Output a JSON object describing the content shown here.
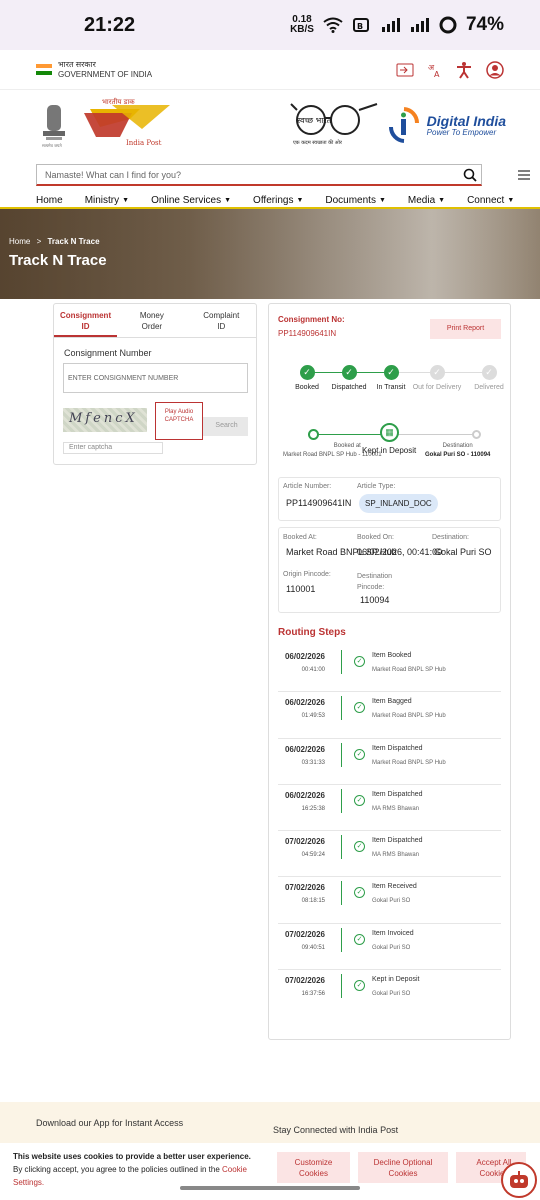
{
  "status_bar": {
    "time": "21:22",
    "speed_value": "0.18",
    "speed_unit": "KB/S",
    "battery": "74%"
  },
  "gov": {
    "hindi": "भारत सरकार",
    "english": "GOVERNMENT OF INDIA"
  },
  "logos": {
    "ip_hindi": "भारतीय डाक",
    "ip_english": "India Post",
    "swachh": "स्वच्छ भारत",
    "di_title": "Digital India",
    "di_sub": "Power To Empower"
  },
  "search": {
    "placeholder": "Namaste! What can I find for you?"
  },
  "nav": [
    "Home",
    "Ministry",
    "Online Services",
    "Offerings",
    "Documents",
    "Media",
    "Connect"
  ],
  "banner": {
    "crumb_home": "Home",
    "crumb_sep": ">",
    "crumb_current": "Track N Trace",
    "title": "Track N Trace"
  },
  "form": {
    "tabs": [
      "Consignment ID",
      "Money Order",
      "Complaint ID"
    ],
    "label": "Consignment Number",
    "input_placeholder": "ENTER CONSIGNMENT NUMBER",
    "captcha_text": "MfencX",
    "audio_label": "Play Audio CAPTCHA",
    "search_label": "Search",
    "captcha_placeholder": "Enter captcha"
  },
  "result": {
    "cons_label": "Consignment No:",
    "cons_no": "PP114909641IN",
    "print_label": "Print Report",
    "steps": [
      {
        "label": "Booked",
        "done": true
      },
      {
        "label": "Dispatched",
        "done": true
      },
      {
        "label": "In Transit",
        "done": true
      },
      {
        "label": "Out for Delivery",
        "done": false
      },
      {
        "label": "Delivered",
        "done": false
      }
    ],
    "journey": {
      "booked_at_label": "Booked at",
      "booked_at": "Market Road BNPL SP Hub - 110001",
      "status": "Kept in Deposit",
      "dest_label": "Destination",
      "dest": "Gokal Puri SO - 110094"
    },
    "article_number_label": "Article Number:",
    "article_number": "PP114909641IN",
    "article_type_label": "Article Type:",
    "article_type": "SP_INLAND_DOC",
    "booked_at_label": "Booked At:",
    "booked_at": "Market Road BNPL SP Hub",
    "booked_on_label": "Booked On:",
    "booked_on": "06/02/2026, 00:41:00",
    "destination_label": "Destination:",
    "destination": "Gokal Puri SO",
    "origin_pin_label": "Origin Pincode:",
    "origin_pin": "110001",
    "dest_pin_label": "Destination Pincode:",
    "dest_pin": "110094",
    "routing_title": "Routing Steps",
    "routing": [
      {
        "date": "06/02/2026",
        "time": "00:41:00",
        "event": "Item Booked",
        "office": "Market Road BNPL SP Hub"
      },
      {
        "date": "06/02/2026",
        "time": "01:49:53",
        "event": "Item Bagged",
        "office": "Market Road BNPL SP Hub"
      },
      {
        "date": "06/02/2026",
        "time": "03:31:33",
        "event": "Item Dispatched",
        "office": "Market Road BNPL SP Hub"
      },
      {
        "date": "06/02/2026",
        "time": "16:25:38",
        "event": "Item Dispatched",
        "office": "MA RMS Bhawan"
      },
      {
        "date": "07/02/2026",
        "time": "04:59:24",
        "event": "Item Dispatched",
        "office": "MA RMS Bhawan"
      },
      {
        "date": "07/02/2026",
        "time": "08:18:15",
        "event": "Item Received",
        "office": "Gokal Puri SO"
      },
      {
        "date": "07/02/2026",
        "time": "09:40:51",
        "event": "Item Invoiced",
        "office": "Gokal Puri SO"
      },
      {
        "date": "07/02/2026",
        "time": "16:37:56",
        "event": "Kept in Deposit",
        "office": "Gokal Puri SO"
      }
    ]
  },
  "footer": {
    "app_text": "Download our App for Instant Access",
    "connect_text": "Stay Connected with India Post"
  },
  "cookie": {
    "line1": "This website uses cookies to provide a better user experience.",
    "line2": "By clicking accept, you agree to the policies outlined in the",
    "link": "Cookie Settings.",
    "customize": "Customize Cookies",
    "decline": "Decline Optional Cookies",
    "accept": "Accept All Cookies"
  }
}
